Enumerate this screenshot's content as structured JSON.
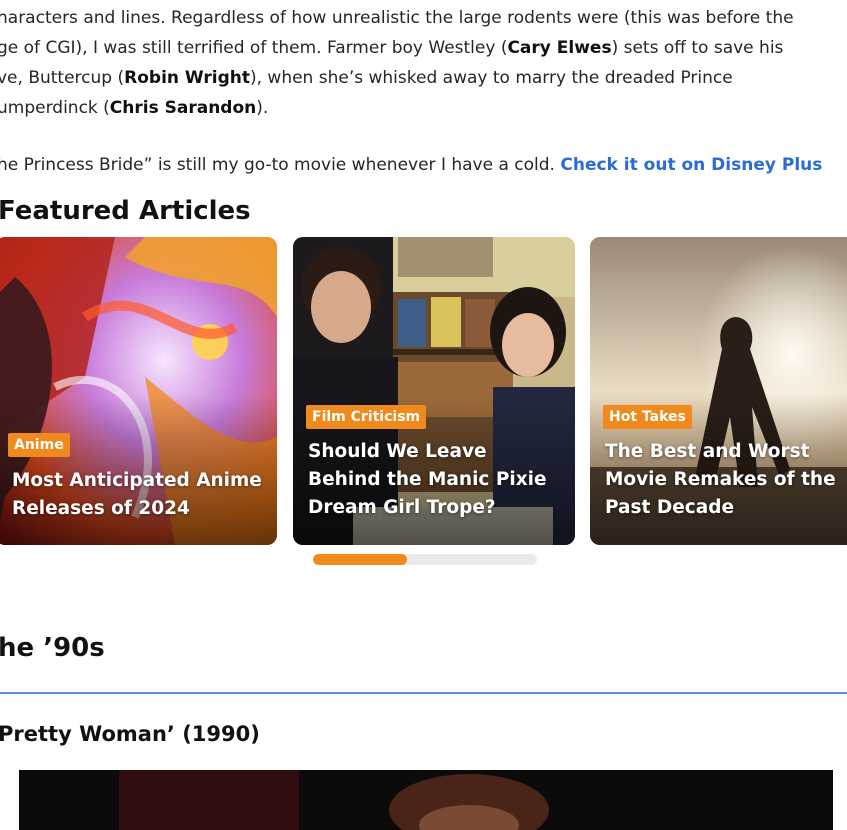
{
  "article": {
    "para1_line1": "haracters and lines. Regardless of how unrealistic the large rodents were (this was before the",
    "para1_line2_a": "ge of CGI), I was still terrified of them. Farmer boy Westley (",
    "para1_line2_b": "Cary Elwes",
    "para1_line2_c": ") sets off to save his",
    "para1_line3_a": "ve, Buttercup (",
    "para1_line3_b": "Robin Wright",
    "para1_line3_c": "), when she’s whisked away to marry the dreaded Prince",
    "para1_line4_a": "umperdinck (",
    "para1_line4_b": "Chris Sarandon",
    "para1_line4_c": ").",
    "para2_text": "he Princess Bride” is still my go-to movie whenever I have a cold. ",
    "para2_link": "Check it out on Disney Plus"
  },
  "featured": {
    "title": "Featured Articles",
    "progress_fraction": 0.42,
    "cards": [
      {
        "tag": "Anime",
        "headline": "Most Anticipated Anime Releases of 2024"
      },
      {
        "tag": "Film Criticism",
        "headline": "Should We Leave Behind the Manic Pixie Dream Girl Trope?"
      },
      {
        "tag": "Hot Takes",
        "headline": "The Best and Worst Movie Remakes of the Past Decade"
      }
    ]
  },
  "nineties": {
    "title": "he ’90s",
    "movie_heading": "Pretty Woman’ (1990)"
  },
  "colors": {
    "accent": "#f08a1c",
    "link": "#2a6bd6",
    "divider": "#5a8fd6"
  }
}
